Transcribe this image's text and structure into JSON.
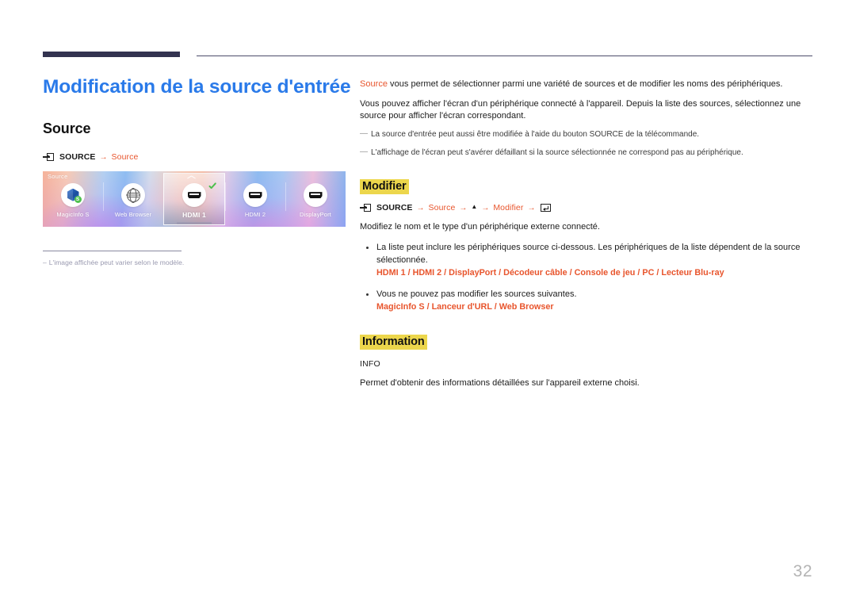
{
  "document": {
    "page_number": "32",
    "title": "Modification de la source d'entrée"
  },
  "colors": {
    "title_blue": "#2a7ae9",
    "accent_orange": "#e8552d",
    "highlight_yellow": "#ecd64c",
    "rule_navy": "#333350",
    "footnote_gray": "#9a9ab0",
    "page_number_gray": "#b4b4b4",
    "check_green": "#4bbf4b"
  },
  "left": {
    "section_heading": "Source",
    "breadcrumb": {
      "key_icon": "source-key-icon",
      "key_label": "SOURCE",
      "arrow": "→",
      "target": "Source"
    },
    "screenshot": {
      "overlay_label": "Source",
      "chevron_icon": "chevron-up-icon",
      "items": [
        {
          "name": "MagicInfo S",
          "icon": "magicinfo-cube-icon",
          "badge": "S",
          "selected": false
        },
        {
          "name": "Web Browser",
          "icon": "globe-icon",
          "selected": false
        },
        {
          "name": "HDMI 1",
          "display_name": "HDMI 1",
          "icon": "hdmi-port-icon",
          "selected": true,
          "check_icon": "check-icon"
        },
        {
          "name": "HDMI 2",
          "icon": "hdmi-port-icon",
          "selected": false
        },
        {
          "name": "DisplayPort",
          "icon": "displayport-icon",
          "selected": false
        }
      ]
    },
    "footnote": {
      "dash": "‒",
      "text": "L'image affichée peut varier selon le modèle."
    }
  },
  "right": {
    "intro": {
      "lead_accent": "Source",
      "lead_rest": " vous permet de sélectionner parmi une variété de sources et de modifier les noms des périphériques.",
      "paragraph2": "Vous pouvez afficher l'écran d'un périphérique connecté à l'appareil. Depuis la liste des sources, sélectionnez une source pour afficher l'écran correspondant.",
      "notes": [
        "La source d'entrée peut aussi être modifiée à l'aide du bouton SOURCE de la télécommande.",
        "L'affichage de l'écran peut s'avérer défaillant si la source sélectionnée ne correspond pas au périphérique."
      ]
    },
    "modifier": {
      "heading": "Modifier",
      "breadcrumb": {
        "key_icon": "source-key-icon",
        "key_label": "SOURCE",
        "step1": "Source",
        "step2_icon": "triangle-up-icon",
        "step3": "Modifier",
        "enter_icon": "enter-key-icon",
        "arrow": "→"
      },
      "description": "Modifiez le nom et le type d'un périphérique externe connecté.",
      "bullets": [
        {
          "text": "La liste peut inclure les périphériques source ci-dessous. Les périphériques de la liste dépendent de la source sélectionnée.",
          "devices": "HDMI 1 / HDMI 2 / DisplayPort / Décodeur câble / Console de jeu / PC / Lecteur Blu-ray"
        },
        {
          "text": "Vous ne pouvez pas modifier les sources suivantes.",
          "devices": "MagicInfo S / Lanceur d'URL / Web Browser"
        }
      ]
    },
    "information": {
      "heading": "Information",
      "key_label": "INFO",
      "description": "Permet d'obtenir des informations détaillées sur l'appareil externe choisi."
    }
  }
}
